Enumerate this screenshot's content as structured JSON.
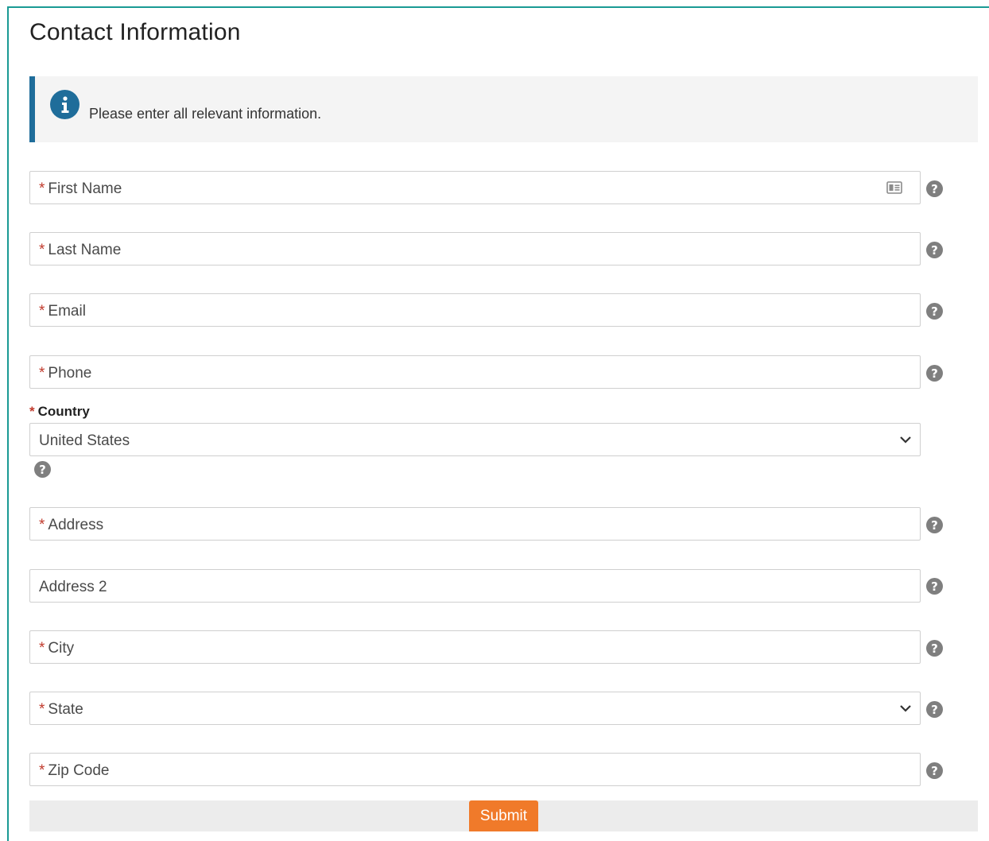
{
  "page": {
    "title": "Contact Information"
  },
  "info_banner": {
    "text": "Please enter all relevant information."
  },
  "required_marker": "*",
  "fields": {
    "first_name": {
      "label": "First Name",
      "required": true
    },
    "last_name": {
      "label": "Last Name",
      "required": true
    },
    "email": {
      "label": "Email",
      "required": true
    },
    "phone": {
      "label": "Phone",
      "required": true
    },
    "country": {
      "label": "Country",
      "required": true,
      "value": "United States"
    },
    "address": {
      "label": "Address",
      "required": true
    },
    "address2": {
      "label": "Address 2",
      "required": false
    },
    "city": {
      "label": "City",
      "required": true
    },
    "state": {
      "label": "State",
      "required": true
    },
    "zip": {
      "label": "Zip Code",
      "required": true
    }
  },
  "help_glyph": "?",
  "submit": {
    "label": "Submit"
  },
  "icons": {
    "info": "info-circle-icon",
    "help": "question-circle-icon",
    "dropdown": "chevron-down-icon",
    "contact_card": "contact-card-icon"
  },
  "colors": {
    "accent_border": "#1a9a94",
    "info_bar": "#1f6d9a",
    "required": "#c0392b",
    "submit_bg": "#f07a2a",
    "help_icon": "#7f7f7f"
  }
}
